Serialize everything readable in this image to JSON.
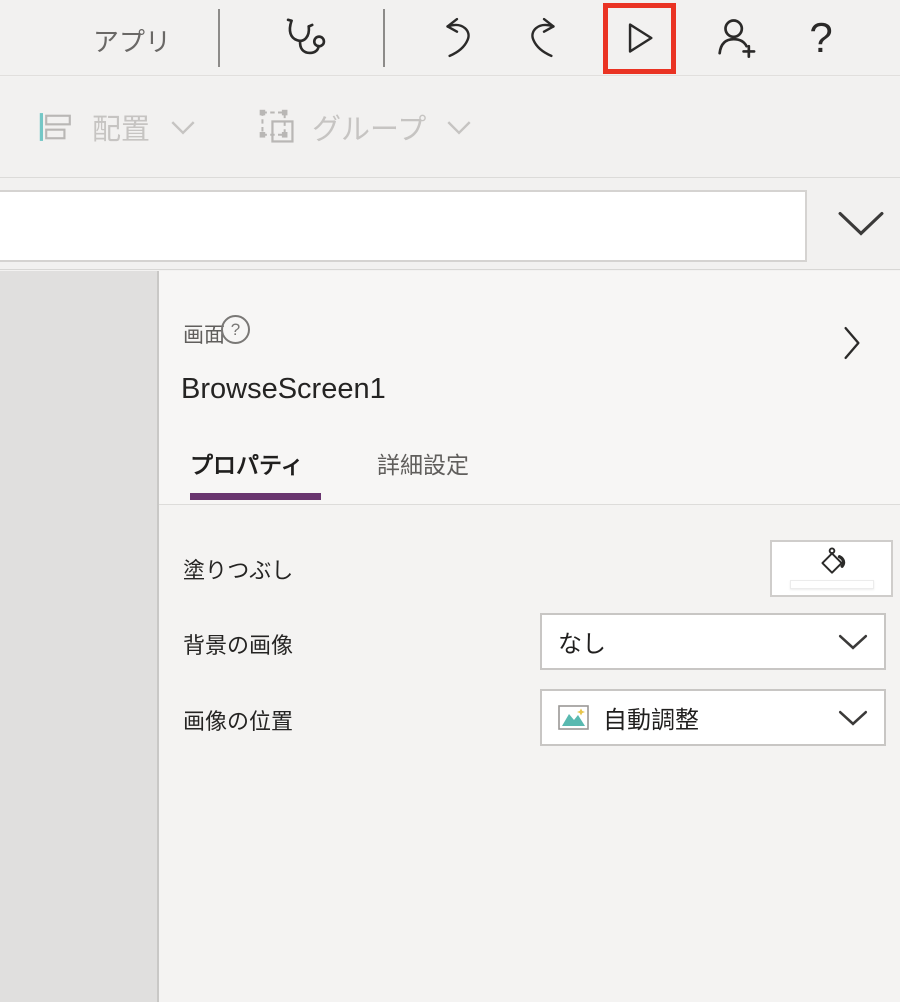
{
  "colors": {
    "accent_purple": "#69356f",
    "highlight_red": "#ea3323",
    "teal_icon": "#59b9b0",
    "canvas_gray": "#e0dfde",
    "toolbar_bg": "#f2f1f0"
  },
  "toolbar": {
    "app_label": "アプリ",
    "help_glyph": "?",
    "icons": {
      "app_checker": "stethoscope-icon",
      "undo": "undo-arrow-icon",
      "redo": "redo-arrow-icon",
      "preview": "play-outline-icon",
      "share": "person-add-icon",
      "help": "question-mark-icon"
    },
    "highlight": "play button outlined in red"
  },
  "ribbon": {
    "align_label": "配置",
    "group_label": "グループ",
    "state": "disabled",
    "icons": {
      "align": "align-left-icon",
      "group": "group-objects-icon"
    }
  },
  "formula_bar": {
    "value": "",
    "placeholder": ""
  },
  "panel": {
    "type_label": "画面",
    "help_glyph": "?",
    "name": "BrowseScreen1",
    "active_tab": "プロパティ",
    "tabs": [
      {
        "label": "プロパティ"
      },
      {
        "label": "詳細設定"
      }
    ],
    "fields": [
      {
        "label": "塗りつぶし",
        "control": "color-swatch-button",
        "swatch_color": "#ffffff"
      },
      {
        "label": "背景の画像",
        "value": "なし"
      },
      {
        "label": "画像の位置",
        "value": "自動調整",
        "icon": "picture-icon"
      }
    ],
    "icons": {
      "screen_help": "circled-question-icon",
      "expand": "chevron-right-icon",
      "dropdown": "chevron-down-icon",
      "fill": "paint-bucket-icon"
    }
  }
}
